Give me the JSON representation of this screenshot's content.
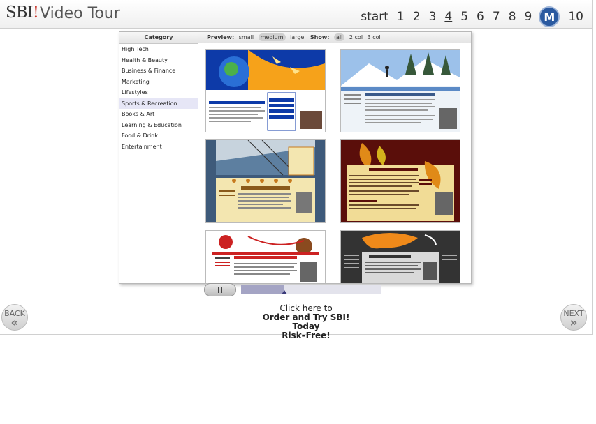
{
  "header": {
    "logo_text": "SBI",
    "logo_bang": "!",
    "title": "Video Tour"
  },
  "nav": {
    "items": [
      "start",
      "1",
      "2",
      "3",
      "4",
      "5",
      "6",
      "7",
      "8",
      "9",
      "M",
      "10"
    ],
    "active": "4"
  },
  "panel": {
    "category_header": "Category",
    "categories": [
      "High Tech",
      "Health & Beauty",
      "Business & Finance",
      "Marketing",
      "Lifestyles",
      "Sports & Recreation",
      "Books & Art",
      "Learning & Education",
      "Food & Drink",
      "Entertainment"
    ],
    "selected_category": "Sports & Recreation",
    "preview_label": "Preview:",
    "preview_sizes": [
      "small",
      "medium",
      "large"
    ],
    "preview_selected": "medium",
    "show_label": "Show:",
    "show_options": [
      "all",
      "2 col",
      "3 col"
    ],
    "show_selected": "all",
    "thumbnails": [
      {
        "headline": "Main H1 Headline",
        "palette": [
          "#0d3aa8",
          "#f6a21a",
          "#ffffff"
        ]
      },
      {
        "headline": "Main H1 Headline",
        "palette": [
          "#5b8ac6",
          "#eef3f8",
          "#333333"
        ]
      },
      {
        "headline": "Main H1 Headline",
        "palette": [
          "#3e5a7a",
          "#f3e6b0",
          "#c77b1e"
        ]
      },
      {
        "headline": "Main H1 Headline",
        "palette": [
          "#5a0e0a",
          "#f1dc96",
          "#e08a18"
        ]
      },
      {
        "headline": "Main H1 Headline",
        "palette": [
          "#cc2222",
          "#ffffff",
          "#8a4a1f"
        ]
      },
      {
        "headline": "MAIN H1 HEADLINE",
        "palette": [
          "#333333",
          "#f08a1a",
          "#d9d9d9"
        ]
      }
    ]
  },
  "playback": {
    "pause_icon": "pause-icon",
    "progress": 0.31
  },
  "footer": {
    "back_label": "BACK",
    "next_label": "NEXT",
    "cta_line1": "Click here to",
    "cta_line2": "Order and Try SBI! Today",
    "cta_line3": "Risk–Free!"
  }
}
